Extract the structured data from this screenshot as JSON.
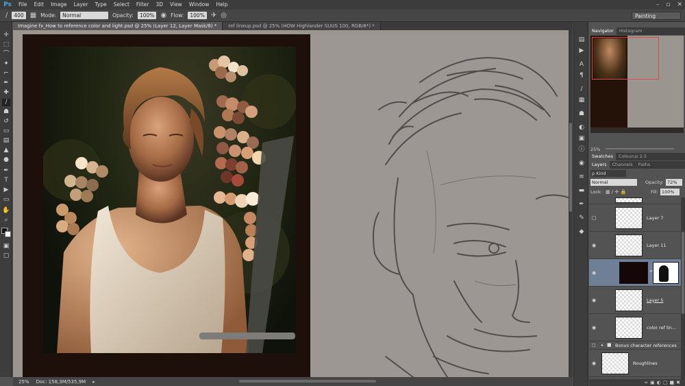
{
  "app": {
    "logo": "Ps"
  },
  "menu": [
    "File",
    "Edit",
    "Image",
    "Layer",
    "Type",
    "Select",
    "Filter",
    "3D",
    "View",
    "Window",
    "Help"
  ],
  "window_controls": [
    "–",
    "▫",
    "✕"
  ],
  "options_bar": {
    "brush_size": "400",
    "mode_label": "Mode:",
    "mode_value": "Normal",
    "opacity_label": "Opacity:",
    "opacity_value": "100%",
    "flow_label": "Flow:",
    "flow_value": "100%",
    "workspace": "Painting"
  },
  "tabs": [
    {
      "label": "Imagine fx_How to reference color and light.psd @ 25% (Layer 12, Layer Mask/8) *",
      "active": true
    },
    {
      "label": "ref lineup.psd @ 25% (HOW Highlander SUUS 100, RGB/8*) *",
      "active": false
    }
  ],
  "status": {
    "zoom": "25%",
    "doc": "Doc: 158,3M/535,9M"
  },
  "panels": {
    "nav_tabs": [
      "Navigator",
      "Histogram"
    ],
    "nav_zoom": "25%",
    "swatch_tabs": [
      "Swatches",
      "Colourus 2.5"
    ],
    "layer_tabs": [
      "Layers",
      "Channels",
      "Paths"
    ],
    "kind_filter": "ρ Kind",
    "blend_mode": "Normal",
    "opacity_label": "Opacity:",
    "opacity_value": "72%",
    "lock_label": "Lock:",
    "fill_label": "Fill:",
    "fill_value": "100%",
    "layers": [
      {
        "name": "Layer 7"
      },
      {
        "name": "Layer 11"
      },
      {
        "name": ""
      },
      {
        "name": "Layer 5"
      },
      {
        "name": "color ref lin..."
      },
      {
        "name": "Bonus character references"
      },
      {
        "name": "Roughlines"
      }
    ]
  },
  "colors": {
    "selected_layer": "#6f7f95",
    "nav_frame": "#e24a4a"
  }
}
